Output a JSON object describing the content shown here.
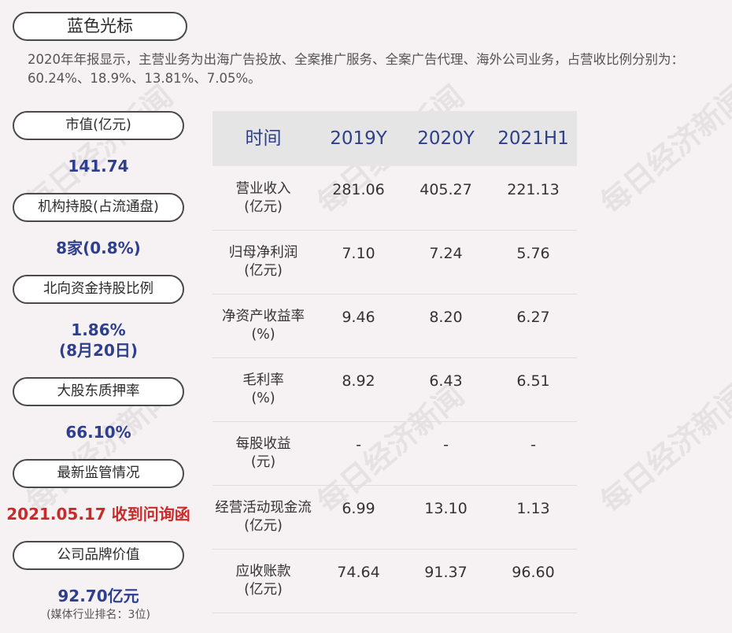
{
  "title": "蓝色光标",
  "summary": "2020年年报显示，主营业务为出海广告投放、全案推广服务、全案广告代理、海外公司业务，占营收比例分别为：60.24%、18.9%、13.81%、7.05%。",
  "sidebar": {
    "market_cap": {
      "label": "市值(亿元)",
      "value": "141.74"
    },
    "institutions": {
      "label": "机构持股(占流通盘)",
      "value": "8家(0.8%)"
    },
    "northbound": {
      "label": "北向资金持股比例",
      "value": "1.86%",
      "value2": "(8月20日)"
    },
    "pledge": {
      "label": "大股东质押率",
      "value": "66.10%"
    },
    "regulation": {
      "label": "最新监管情况",
      "value": "2021.05.17 收到问询函"
    },
    "brand": {
      "label": "公司品牌价值",
      "value": "92.70亿元",
      "note": "(媒体行业排名：3位)"
    }
  },
  "table": {
    "headers": [
      "时间",
      "2019Y",
      "2020Y",
      "2021H1"
    ],
    "rows": [
      {
        "label": "营业收入\n(亿元)",
        "values": [
          "281.06",
          "405.27",
          "221.13"
        ]
      },
      {
        "label": "归母净利润\n(亿元)",
        "values": [
          "7.10",
          "7.24",
          "5.76"
        ]
      },
      {
        "label": "净资产收益率\n(%)",
        "values": [
          "9.46",
          "8.20",
          "6.27"
        ]
      },
      {
        "label": "毛利率\n(%)",
        "values": [
          "8.92",
          "6.43",
          "6.51"
        ]
      },
      {
        "label": "每股收益\n(元)",
        "values": [
          "-",
          "-",
          "-"
        ]
      },
      {
        "label": "经营活动现金流\n(亿元)",
        "values": [
          "6.99",
          "13.10",
          "1.13"
        ]
      },
      {
        "label": "应收账款\n(亿元)",
        "values": [
          "74.64",
          "91.37",
          "96.60"
        ]
      }
    ]
  },
  "watermark": "每日经济新闻"
}
